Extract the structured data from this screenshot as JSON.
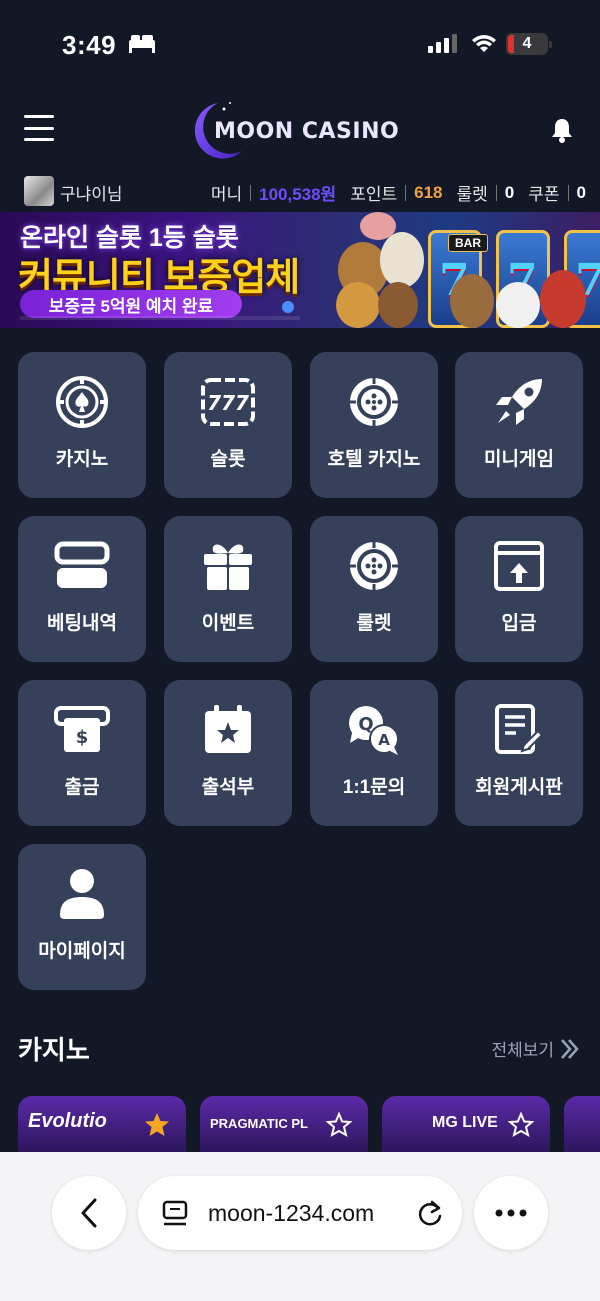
{
  "status_bar": {
    "time": "3:49",
    "battery": "4"
  },
  "header": {
    "logo_text": "MOON CASINO"
  },
  "user": {
    "name": "구냐이님",
    "money_label": "머니",
    "money_value": "100,538원",
    "point_label": "포인트",
    "point_value": "618",
    "roulette_label": "룰렛",
    "roulette_value": "0",
    "coupon_label": "쿠폰",
    "coupon_value": "0"
  },
  "banner": {
    "line1": "온라인 슬롯 1등 슬롯",
    "line2": "커뮤니티 보증업체",
    "line3": "보증금 5억원 예치 완료",
    "bar_text": "BAR"
  },
  "menu": [
    {
      "label": "카지노",
      "icon": "casino-chip-icon"
    },
    {
      "label": "슬롯",
      "icon": "slot-777-icon"
    },
    {
      "label": "호텔 카지노",
      "icon": "roulette-wheel-icon"
    },
    {
      "label": "미니게임",
      "icon": "rocket-icon"
    },
    {
      "label": "베팅내역",
      "icon": "betting-history-icon"
    },
    {
      "label": "이벤트",
      "icon": "gift-icon"
    },
    {
      "label": "룰렛",
      "icon": "roulette-icon"
    },
    {
      "label": "입금",
      "icon": "deposit-icon"
    },
    {
      "label": "출금",
      "icon": "withdraw-icon"
    },
    {
      "label": "출석부",
      "icon": "attendance-calendar-icon"
    },
    {
      "label": "1:1문의",
      "icon": "qa-chat-icon"
    },
    {
      "label": "회원게시판",
      "icon": "board-icon"
    },
    {
      "label": "마이페이지",
      "icon": "user-icon"
    }
  ],
  "casino_section": {
    "title": "카지노",
    "see_all": "전체보기",
    "cards": [
      {
        "label": "Evolutio",
        "favorite": true
      },
      {
        "label": "PRAGMATIC PL",
        "favorite": false
      },
      {
        "label": "MG LIVE",
        "favorite": false
      }
    ]
  },
  "browser": {
    "url": "moon-1234.com"
  },
  "colors": {
    "background": "#121826",
    "tile": "#35405a",
    "money": "#6f4dff",
    "point": "#f2a23a",
    "favorite_star": "#f5a623"
  }
}
